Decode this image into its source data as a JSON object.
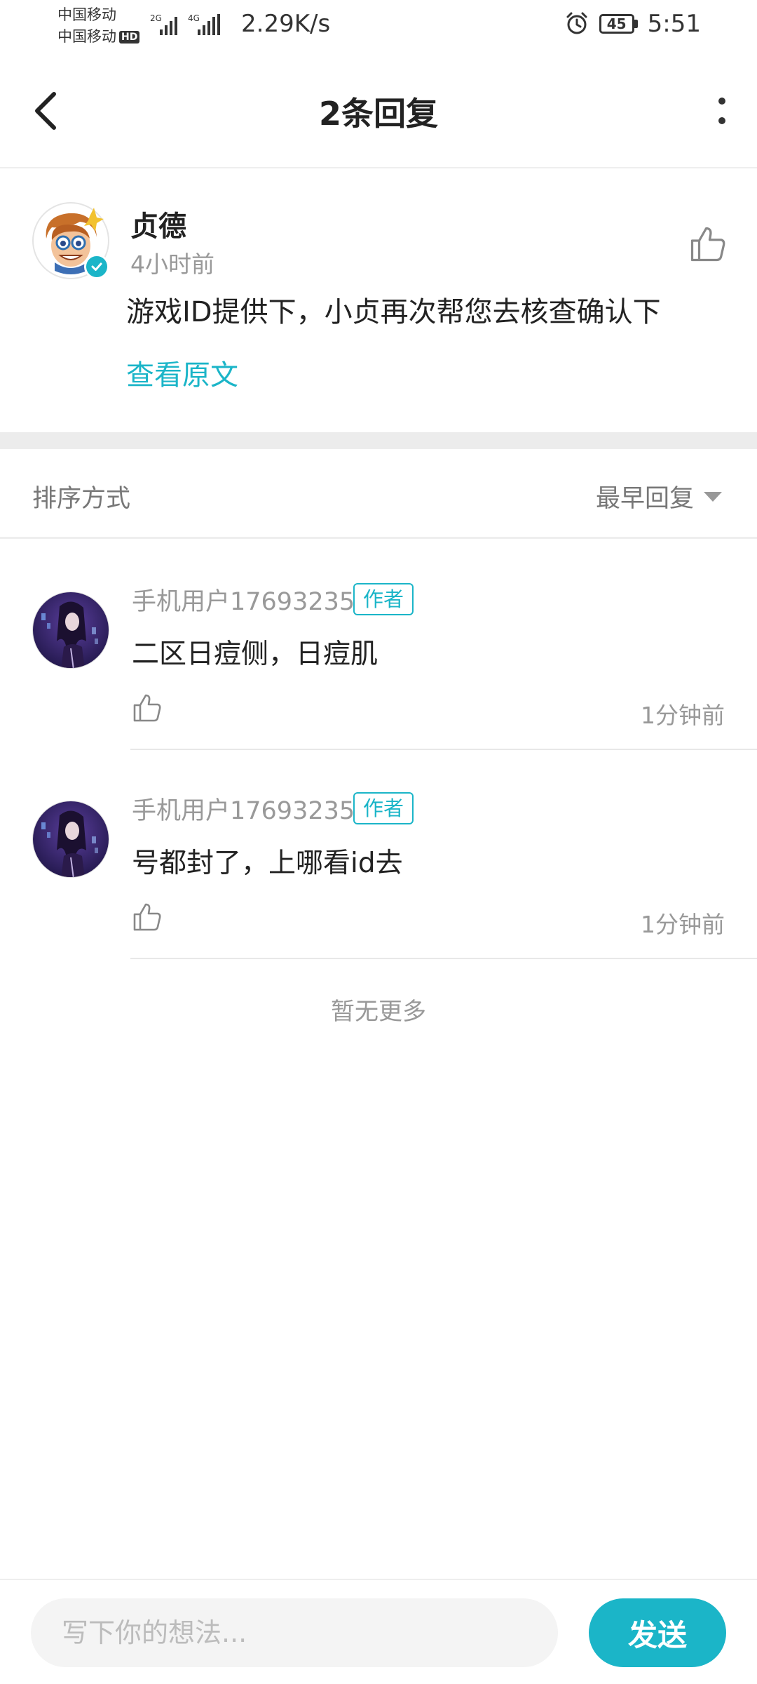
{
  "status_bar": {
    "carrier_1": "中国移动",
    "carrier_2": "中国移动",
    "hd": "HD",
    "net_type_1": "2G",
    "net_type_2": "4G",
    "net_speed": "2.29K/s",
    "battery": "45",
    "time": "5:51",
    "icons": [
      "signal-icon",
      "alarm-icon",
      "battery-icon"
    ]
  },
  "header": {
    "title": "2条回复",
    "back_icon": "back-chevron-icon",
    "more_icon": "more-vertical-icon"
  },
  "original_comment": {
    "author": "贞德",
    "time": "4小时前",
    "text": "游戏ID提供下，小贞再次帮您去核查确认下",
    "view_original": "查看原文",
    "verified": true
  },
  "sort": {
    "label": "排序方式",
    "selected": "最早回复"
  },
  "replies": [
    {
      "username": "手机用户17693235",
      "tag": "作者",
      "content": "二区日痘侧，日痘肌",
      "time": "1分钟前"
    },
    {
      "username": "手机用户17693235",
      "tag": "作者",
      "content": "号都封了，上哪看id去",
      "time": "1分钟前"
    }
  ],
  "no_more": "暂无更多",
  "bottom_bar": {
    "placeholder": "写下你的想法...",
    "send_label": "发送"
  },
  "colors": {
    "accent": "#1bb5c8",
    "text_primary": "#222222",
    "text_secondary": "#999999",
    "divider": "#ececec"
  }
}
